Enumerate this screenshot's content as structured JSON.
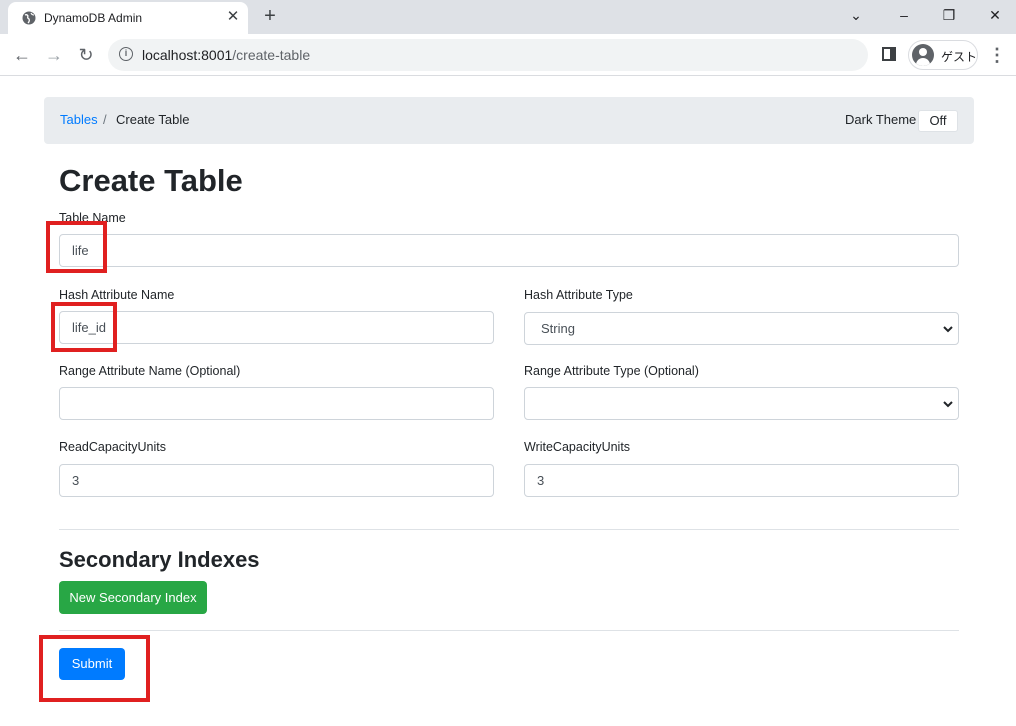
{
  "browser": {
    "tab_title": "DynamoDB Admin",
    "tab_close": "✕",
    "new_tab": "+",
    "url_host": "localhost:8001",
    "url_path": "/create-table",
    "profile_label": "ゲスト",
    "window_controls": {
      "minimize": "–",
      "restore": "❐",
      "close": "✕",
      "tab_search": "⌄"
    },
    "nav": {
      "back": "←",
      "forward": "→",
      "reload": "↻"
    },
    "menu": "⋮"
  },
  "breadcrumb": {
    "tables_link": "Tables",
    "separator": "/",
    "current": "Create Table"
  },
  "dark_theme": {
    "label": "Dark Theme",
    "toggle": "Off"
  },
  "form": {
    "title": "Create Table",
    "table_name": {
      "label": "Table Name",
      "value": "life"
    },
    "hash_attribute_name": {
      "label": "Hash Attribute Name",
      "value": "life_id"
    },
    "hash_attribute_type": {
      "label": "Hash Attribute Type",
      "value": "String"
    },
    "range_attribute_name": {
      "label": "Range Attribute Name (Optional)",
      "value": ""
    },
    "range_attribute_type": {
      "label": "Range Attribute Type (Optional)",
      "value": ""
    },
    "read_capacity": {
      "label": "ReadCapacityUnits",
      "value": "3"
    },
    "write_capacity": {
      "label": "WriteCapacityUnits",
      "value": "3"
    }
  },
  "secondary_indexes": {
    "title": "Secondary Indexes",
    "new_button": "New Secondary Index"
  },
  "submit_label": "Submit",
  "colors": {
    "primary": "#007bff",
    "success": "#28a745",
    "highlight": "#e02020"
  }
}
